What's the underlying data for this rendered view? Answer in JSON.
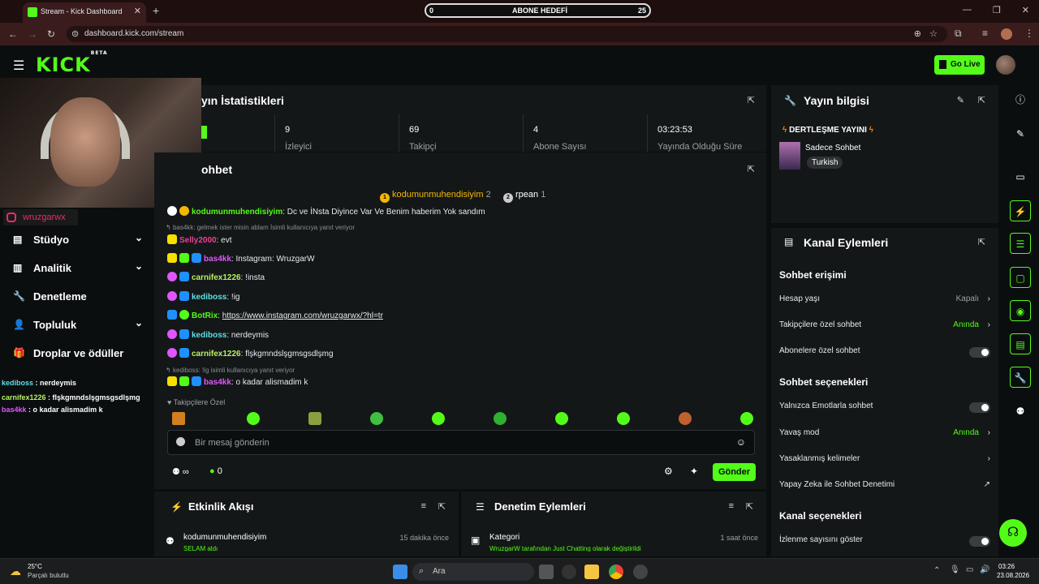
{
  "browser": {
    "tab_title": "Stream - Kick Dashboard",
    "url": "dashboard.kick.com/stream",
    "goal": {
      "label": "ABONE HEDEFİ",
      "current": "0",
      "target": "25"
    }
  },
  "header": {
    "logo": "KICK",
    "logo_badge": "BETA",
    "go_live": "Go Live"
  },
  "overlay": {
    "instagram": "wruzgarwx",
    "chat": [
      {
        "user": "kediboss",
        "sep": " : ",
        "text": "nerdeymis"
      },
      {
        "user": "carnifex1226",
        "sep": " : ",
        "text": "flşkgmndslşgmsgsdlşmg"
      },
      {
        "user": "bas4kk",
        "sep": " : ",
        "text": "o kadar alismadim k"
      }
    ]
  },
  "sidebar": {
    "items": [
      {
        "label": "Stüdyo"
      },
      {
        "label": "Analitik"
      },
      {
        "label": "Denetleme"
      },
      {
        "label": "Topluluk"
      },
      {
        "label": "Droplar ve ödüller"
      }
    ]
  },
  "stats": {
    "title": "yın İstatistikleri",
    "cells": [
      {
        "value": "9",
        "label": "İzleyici"
      },
      {
        "value": "69",
        "label": "Takipçi"
      },
      {
        "value": "4",
        "label": "Abone Sayısı"
      },
      {
        "value": "03:23:53",
        "label": "Yayında Olduğu Süre"
      }
    ]
  },
  "chat": {
    "title": "ohbet",
    "leaders": [
      {
        "rank": "1",
        "name": "kodumunmuhendisiyim",
        "count": "2"
      },
      {
        "rank": "2",
        "name": "rpean",
        "count": "1"
      }
    ],
    "messages": [
      {
        "user": "kodumunmuhendisiyim",
        "text": ": Dc ve İNsta Diyince Var Ve Benim haberim Yok sandım",
        "color": "#53fc18"
      },
      {
        "reply": "bas4kk: gelmek ister misin ablam İsimli kullanıcıya yanıt veriyor"
      },
      {
        "user": "Selly2000",
        "text": ": evt",
        "color": "#e84393"
      },
      {
        "user": "bas4kk",
        "text": ": Instagram: WruzgarW",
        "color": "#e056fd"
      },
      {
        "user": "carnifex1226",
        "text": ": !insta",
        "color": "#b8f060"
      },
      {
        "user": "kediboss",
        "text": ": !ig",
        "color": "#5ce1e6"
      },
      {
        "user": "BotRix",
        "text": ": ",
        "link": "https://www.instagram.com/wruzgarwx/?hl=tr",
        "color": "#53fc18"
      },
      {
        "user": "kediboss",
        "text": ": nerdeymis",
        "color": "#5ce1e6"
      },
      {
        "user": "carnifex1226",
        "text": ": flşkgmndslşgmsgsdlşmg",
        "color": "#b8f060"
      },
      {
        "reply": "kediboss: !ig isimli kullanıcıya yanıt veriyor"
      },
      {
        "user": "bas4kk",
        "text": ": o kadar alismadim k",
        "color": "#e056fd"
      }
    ],
    "followers_only": "Takipçilere Özel",
    "placeholder": "Bir mesaj gönderin",
    "infinity": "∞",
    "points": "0",
    "send": "Gönder"
  },
  "activity": {
    "title": "Etkinlik Akışı",
    "item_user": "kodumunmuhendisiyim",
    "item_time": "15 dakika önce",
    "item_sub": "SELAM aldı"
  },
  "moderation": {
    "title": "Denetim Eylemleri",
    "item_title": "Kategori",
    "item_time": "1 saat önce",
    "item_sub": "WruzgarW tarafından Just Chatting olarak değiştirildi"
  },
  "stream_info": {
    "title": "Yayın bilgisi",
    "stream_title": "DERTLEŞME YAYINI",
    "category": "Sadece Sohbet",
    "language": "Turkish"
  },
  "channel_actions": {
    "title": "Kanal Eylemleri",
    "chat_access": "Sohbet erişimi",
    "account_age": "Hesap yaşı",
    "account_age_val": "Kapalı",
    "followers_chat": "Takipçilere özel sohbet",
    "followers_chat_val": "Anında",
    "subs_chat": "Abonelere özel sohbet",
    "chat_options": "Sohbet seçenekleri",
    "emote_only": "Yalnızca Emotlarla sohbet",
    "slow_mode": "Yavaş mod",
    "slow_mode_val": "Anında",
    "banned_words": "Yasaklanmış kelimeler",
    "ai_mod": "Yapay Zeka ile Sohbet Denetimi",
    "channel_options": "Kanal seçenekleri",
    "show_viewers": "İzlenme sayısını göster"
  },
  "taskbar": {
    "temp": "25°C",
    "weather": "Parçalı bulutlu",
    "search": "Ara",
    "time": "03:26",
    "date": "23.08.2026"
  },
  "colors": {
    "accent": "#53fc18",
    "bg": "#0b0e0f",
    "panel": "#141718"
  }
}
